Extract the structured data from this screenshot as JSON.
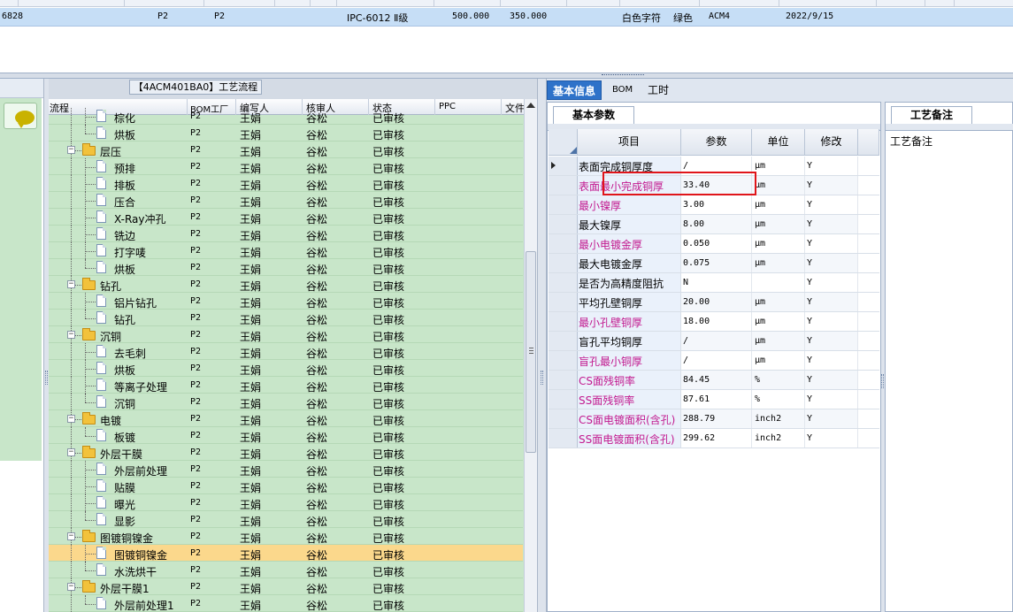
{
  "top_grid": {
    "row": {
      "id_tail": "6828",
      "col_a": "P2",
      "col_b": "P2",
      "model": "IPC-6012 Ⅱ级",
      "v1": "500.000",
      "v2": "350.000",
      "text_color": "白色字符",
      "mask_color": "绿色",
      "code": "ACM4",
      "date": "2022/9/15"
    }
  },
  "tree": {
    "title": "【4ACM401BA0】工艺流程",
    "headers": {
      "flow": "流程",
      "bom": "BOM工厂",
      "author": "编写人",
      "reviewer": "核审人",
      "status": "状态",
      "ppc": "PPC",
      "file": "文件"
    },
    "rows": [
      {
        "name": "棕化",
        "level": 2,
        "bom": "P2",
        "author": "王娟",
        "reviewer": "谷松",
        "status": "已审核"
      },
      {
        "name": "烘板",
        "level": 2,
        "bom": "P2",
        "author": "王娟",
        "reviewer": "谷松",
        "status": "已审核"
      },
      {
        "name": "层压",
        "level": 1,
        "bom": "P2",
        "author": "王娟",
        "reviewer": "谷松",
        "status": "已审核"
      },
      {
        "name": "预排",
        "level": 2,
        "bom": "P2",
        "author": "王娟",
        "reviewer": "谷松",
        "status": "已审核"
      },
      {
        "name": "排板",
        "level": 2,
        "bom": "P2",
        "author": "王娟",
        "reviewer": "谷松",
        "status": "已审核"
      },
      {
        "name": "压合",
        "level": 2,
        "bom": "P2",
        "author": "王娟",
        "reviewer": "谷松",
        "status": "已审核"
      },
      {
        "name": "X-Ray冲孔",
        "level": 2,
        "bom": "P2",
        "author": "王娟",
        "reviewer": "谷松",
        "status": "已审核"
      },
      {
        "name": "铣边",
        "level": 2,
        "bom": "P2",
        "author": "王娟",
        "reviewer": "谷松",
        "status": "已审核"
      },
      {
        "name": "打字唛",
        "level": 2,
        "bom": "P2",
        "author": "王娟",
        "reviewer": "谷松",
        "status": "已审核"
      },
      {
        "name": "烘板",
        "level": 2,
        "bom": "P2",
        "author": "王娟",
        "reviewer": "谷松",
        "status": "已审核"
      },
      {
        "name": "钻孔",
        "level": 1,
        "bom": "P2",
        "author": "王娟",
        "reviewer": "谷松",
        "status": "已审核"
      },
      {
        "name": "铝片钻孔",
        "level": 2,
        "bom": "P2",
        "author": "王娟",
        "reviewer": "谷松",
        "status": "已审核"
      },
      {
        "name": "钻孔",
        "level": 2,
        "bom": "P2",
        "author": "王娟",
        "reviewer": "谷松",
        "status": "已审核"
      },
      {
        "name": "沉铜",
        "level": 1,
        "bom": "P2",
        "author": "王娟",
        "reviewer": "谷松",
        "status": "已审核"
      },
      {
        "name": "去毛刺",
        "level": 2,
        "bom": "P2",
        "author": "王娟",
        "reviewer": "谷松",
        "status": "已审核"
      },
      {
        "name": "烘板",
        "level": 2,
        "bom": "P2",
        "author": "王娟",
        "reviewer": "谷松",
        "status": "已审核"
      },
      {
        "name": "等离子处理",
        "level": 2,
        "bom": "P2",
        "author": "王娟",
        "reviewer": "谷松",
        "status": "已审核"
      },
      {
        "name": "沉铜",
        "level": 2,
        "bom": "P2",
        "author": "王娟",
        "reviewer": "谷松",
        "status": "已审核"
      },
      {
        "name": "电镀",
        "level": 1,
        "bom": "P2",
        "author": "王娟",
        "reviewer": "谷松",
        "status": "已审核"
      },
      {
        "name": "板镀",
        "level": 2,
        "bom": "P2",
        "author": "王娟",
        "reviewer": "谷松",
        "status": "已审核"
      },
      {
        "name": "外层干膜",
        "level": 1,
        "bom": "P2",
        "author": "王娟",
        "reviewer": "谷松",
        "status": "已审核"
      },
      {
        "name": "外层前处理",
        "level": 2,
        "bom": "P2",
        "author": "王娟",
        "reviewer": "谷松",
        "status": "已审核"
      },
      {
        "name": "贴膜",
        "level": 2,
        "bom": "P2",
        "author": "王娟",
        "reviewer": "谷松",
        "status": "已审核"
      },
      {
        "name": "曝光",
        "level": 2,
        "bom": "P2",
        "author": "王娟",
        "reviewer": "谷松",
        "status": "已审核"
      },
      {
        "name": "显影",
        "level": 2,
        "bom": "P2",
        "author": "王娟",
        "reviewer": "谷松",
        "status": "已审核"
      },
      {
        "name": "图镀铜镍金",
        "level": 1,
        "bom": "P2",
        "author": "王娟",
        "reviewer": "谷松",
        "status": "已审核"
      },
      {
        "name": "图镀铜镍金",
        "level": 2,
        "bom": "P2",
        "author": "王娟",
        "reviewer": "谷松",
        "status": "已审核",
        "selected": true
      },
      {
        "name": "水洗烘干",
        "level": 2,
        "bom": "P2",
        "author": "王娟",
        "reviewer": "谷松",
        "status": "已审核"
      },
      {
        "name": "外层干膜1",
        "level": 1,
        "bom": "P2",
        "author": "王娟",
        "reviewer": "谷松",
        "status": "已审核"
      },
      {
        "name": "外层前处理1",
        "level": 2,
        "bom": "P2",
        "author": "王娟",
        "reviewer": "谷松",
        "status": "已审核"
      }
    ]
  },
  "tabs": [
    "基本信息",
    "BOM",
    "工时"
  ],
  "basic": {
    "panel_title": "基本参数",
    "headers": {
      "item": "项目",
      "param": "参数",
      "unit": "单位",
      "modify": "修改"
    },
    "rows": [
      {
        "name": "表面完成铜厚度",
        "value": "/",
        "unit": "μm",
        "modify": "Y",
        "pink": false
      },
      {
        "name": "表面最小完成铜厚",
        "value": "33.40",
        "unit": "μm",
        "modify": "Y",
        "pink": true
      },
      {
        "name": "最小镍厚",
        "value": "3.00",
        "unit": "μm",
        "modify": "Y",
        "pink": true
      },
      {
        "name": "最大镍厚",
        "value": "8.00",
        "unit": "μm",
        "modify": "Y",
        "pink": false
      },
      {
        "name": "最小电镀金厚",
        "value": "0.050",
        "unit": "μm",
        "modify": "Y",
        "pink": true
      },
      {
        "name": "最大电镀金厚",
        "value": "0.075",
        "unit": "μm",
        "modify": "Y",
        "pink": false
      },
      {
        "name": "是否为高精度阻抗",
        "value": "N",
        "unit": "",
        "modify": "Y",
        "pink": false
      },
      {
        "name": "平均孔壁铜厚",
        "value": "20.00",
        "unit": "μm",
        "modify": "Y",
        "pink": false
      },
      {
        "name": "最小孔壁铜厚",
        "value": "18.00",
        "unit": "μm",
        "modify": "Y",
        "pink": true
      },
      {
        "name": "盲孔平均铜厚",
        "value": "/",
        "unit": "μm",
        "modify": "Y",
        "pink": false
      },
      {
        "name": "盲孔最小铜厚",
        "value": "/",
        "unit": "μm",
        "modify": "Y",
        "pink": true
      },
      {
        "name": "CS面残铜率",
        "value": "84.45",
        "unit": "%",
        "modify": "Y",
        "pink": true
      },
      {
        "name": "SS面残铜率",
        "value": "87.61",
        "unit": "%",
        "modify": "Y",
        "pink": true
      },
      {
        "name": "CS面电镀面积(含孔)",
        "value": "288.79",
        "unit": "inch2",
        "modify": "Y",
        "pink": true
      },
      {
        "name": "SS面电镀面积(含孔)",
        "value": "299.62",
        "unit": "inch2",
        "modify": "Y",
        "pink": true
      }
    ]
  },
  "remark": {
    "panel_title": "工艺备注",
    "label": "工艺备注"
  },
  "colors": {
    "pink_text": "#c2198f",
    "selection": "#fbd88c",
    "tree_bg": "#c8e6c9",
    "active_tab": "#2e72c9",
    "highlight": "#e0151a"
  }
}
